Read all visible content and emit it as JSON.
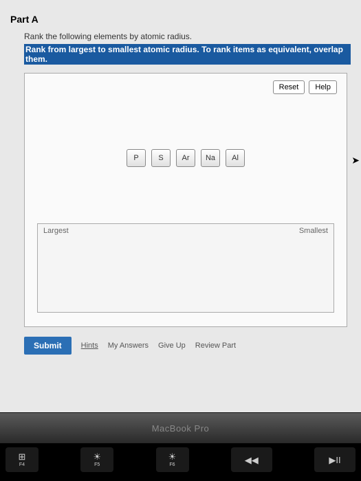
{
  "part": {
    "heading": "Part A",
    "question": "Rank the following elements by atomic radius.",
    "instruction": "Rank from largest to smallest atomic radius. To rank items as equivalent, overlap them."
  },
  "workspace": {
    "reset_label": "Reset",
    "help_label": "Help",
    "tiles": [
      "P",
      "S",
      "Ar",
      "Na",
      "Al"
    ],
    "drop_left": "Largest",
    "drop_right": "Smallest"
  },
  "actions": {
    "submit": "Submit",
    "hints": "Hints",
    "my_answers": "My Answers",
    "give_up": "Give Up",
    "review": "Review Part"
  },
  "hardware": {
    "brand": "MacBook Pro",
    "keys": {
      "f4": "F4",
      "f5": "F5",
      "f6": "F6"
    }
  }
}
